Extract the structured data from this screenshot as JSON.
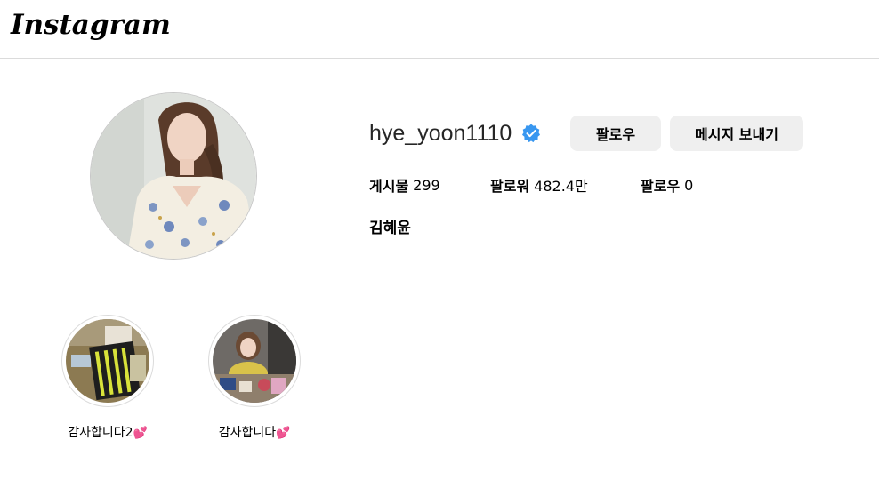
{
  "header": {
    "logo_text": "Instagram"
  },
  "profile": {
    "username": "hye_yoon1110",
    "verified": true,
    "full_name": "김혜윤",
    "stats": {
      "posts_label": "게시물",
      "posts_value": "299",
      "followers_label": "팔로워",
      "followers_value": "482.4만",
      "following_label": "팔로우",
      "following_value": "0"
    },
    "buttons": {
      "follow": "팔로우",
      "message": "메시지 보내기"
    }
  },
  "highlights": [
    {
      "label": "감사합니다2",
      "emoji": "💕"
    },
    {
      "label": "감사합니다",
      "emoji": "💕"
    }
  ],
  "colors": {
    "verified_blue": "#3897f0",
    "button_bg": "#efefef",
    "border": "#dbdbdb"
  }
}
